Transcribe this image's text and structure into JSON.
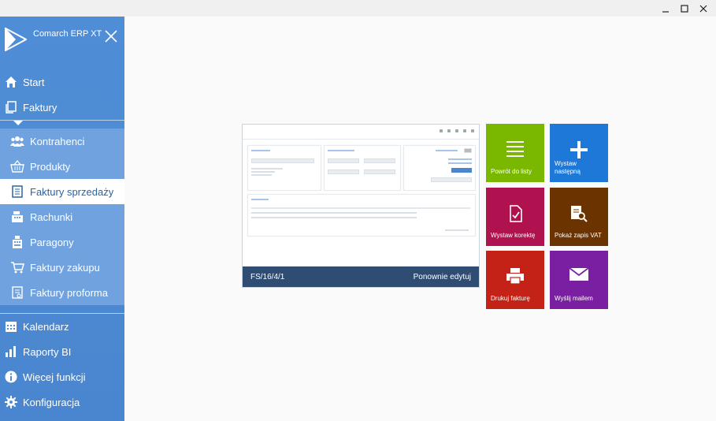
{
  "app": {
    "name": "Comarch ERP XT"
  },
  "sidebar": {
    "items": [
      {
        "label": "Start",
        "icon": "home-icon"
      },
      {
        "label": "Faktury",
        "icon": "documents-icon"
      },
      {
        "label": "Kontrahenci",
        "icon": "users-icon"
      },
      {
        "label": "Produkty",
        "icon": "basket-icon"
      },
      {
        "label": "Faktury sprzedaży",
        "icon": "document-icon"
      },
      {
        "label": "Rachunki",
        "icon": "cash-register-icon"
      },
      {
        "label": "Paragony",
        "icon": "receipt-printer-icon"
      },
      {
        "label": "Faktury zakupu",
        "icon": "cart-icon"
      },
      {
        "label": "Faktury proforma",
        "icon": "proforma-icon"
      },
      {
        "label": "Kalendarz",
        "icon": "calendar-icon"
      },
      {
        "label": "Raporty BI",
        "icon": "bar-chart-icon"
      },
      {
        "label": "Więcej funkcji",
        "icon": "info-icon"
      },
      {
        "label": "Konfiguracja",
        "icon": "gear-icon"
      }
    ]
  },
  "preview": {
    "document_number": "FS/16/4/1",
    "edit_again": "Ponownie edytuj"
  },
  "tiles": [
    {
      "label": "Powrót do listy",
      "color": "#7ab800",
      "icon": "list-icon"
    },
    {
      "label": "Wystaw następną",
      "color": "#1e78d8",
      "icon": "plus-icon"
    },
    {
      "label": "Wystaw korektę",
      "color": "#b0124f",
      "icon": "correction-icon"
    },
    {
      "label": "Pokaż zapis VAT",
      "color": "#6b3300",
      "icon": "vat-search-icon"
    },
    {
      "label": "Drukuj fakturę",
      "color": "#c42117",
      "icon": "printer-icon"
    },
    {
      "label": "Wyślij mailem",
      "color": "#7a1fa2",
      "icon": "mail-icon"
    }
  ],
  "colors": {
    "sidebar": "#4f8ed6",
    "submenu": "#6fa2de",
    "preview_bar": "#2f4d73"
  }
}
